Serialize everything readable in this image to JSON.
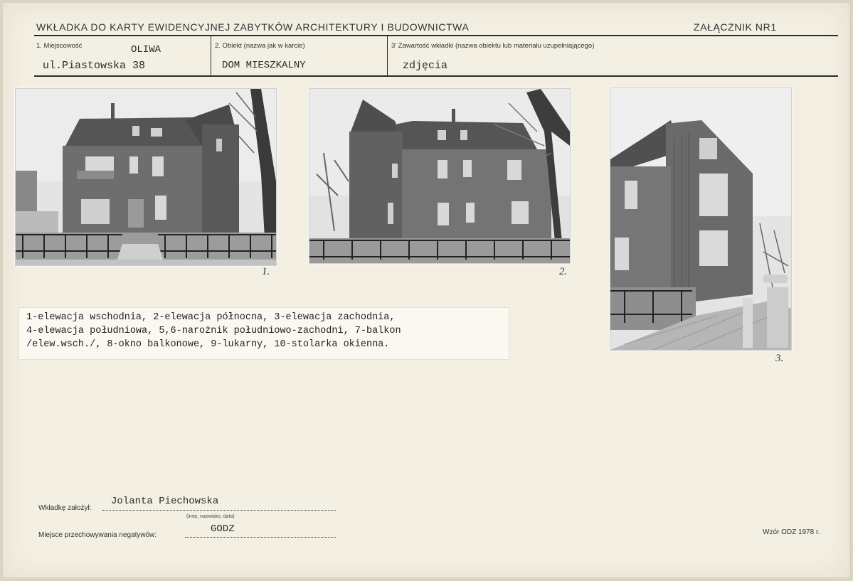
{
  "header": {
    "title": "WKŁADKA DO KARTY EWIDENCYJNEJ ZABYTKÓW ARCHITEKTURY I BUDOWNICTWA",
    "annex": "ZAŁĄCZNIK NR1"
  },
  "fields": {
    "location_label": "1. Miejscowość",
    "location_value": "OLIWA",
    "address_value": "ul.Piastowska 38",
    "object_label": "2. Obiekt (nazwa jak w karcie)",
    "object_value": "DOM MIESZKALNY",
    "contents_label": "3' Zawartość wkładki (nazwa obiektu lub materiału uzupełniającego)",
    "contents_value": "zdjęcia"
  },
  "photos": [
    {
      "number": "1.",
      "subject": "east elevation photo"
    },
    {
      "number": "2.",
      "subject": "north elevation photo"
    },
    {
      "number": "3.",
      "subject": "west elevation photo"
    }
  ],
  "legend": {
    "line1": "1-elewacja wschodnia, 2-elewacja północna, 3-elewacja zachodnia,",
    "line2": "4-elewacja południowa, 5,6-narożnik południowo-zachodni, 7-balkon",
    "line3": "/elew.wsch./, 8-okno balkonowe, 9-lukarny, 10-stolarka okienna."
  },
  "footer": {
    "created_label": "Wkładkę założył:",
    "created_value": "Jolanta Piechowska",
    "created_hint": "(imię, nazwisko, data)",
    "storage_label": "Miejsce przechowywania negatywów:",
    "storage_value": "GODZ",
    "form": "Wzór ODZ 1978 r."
  }
}
